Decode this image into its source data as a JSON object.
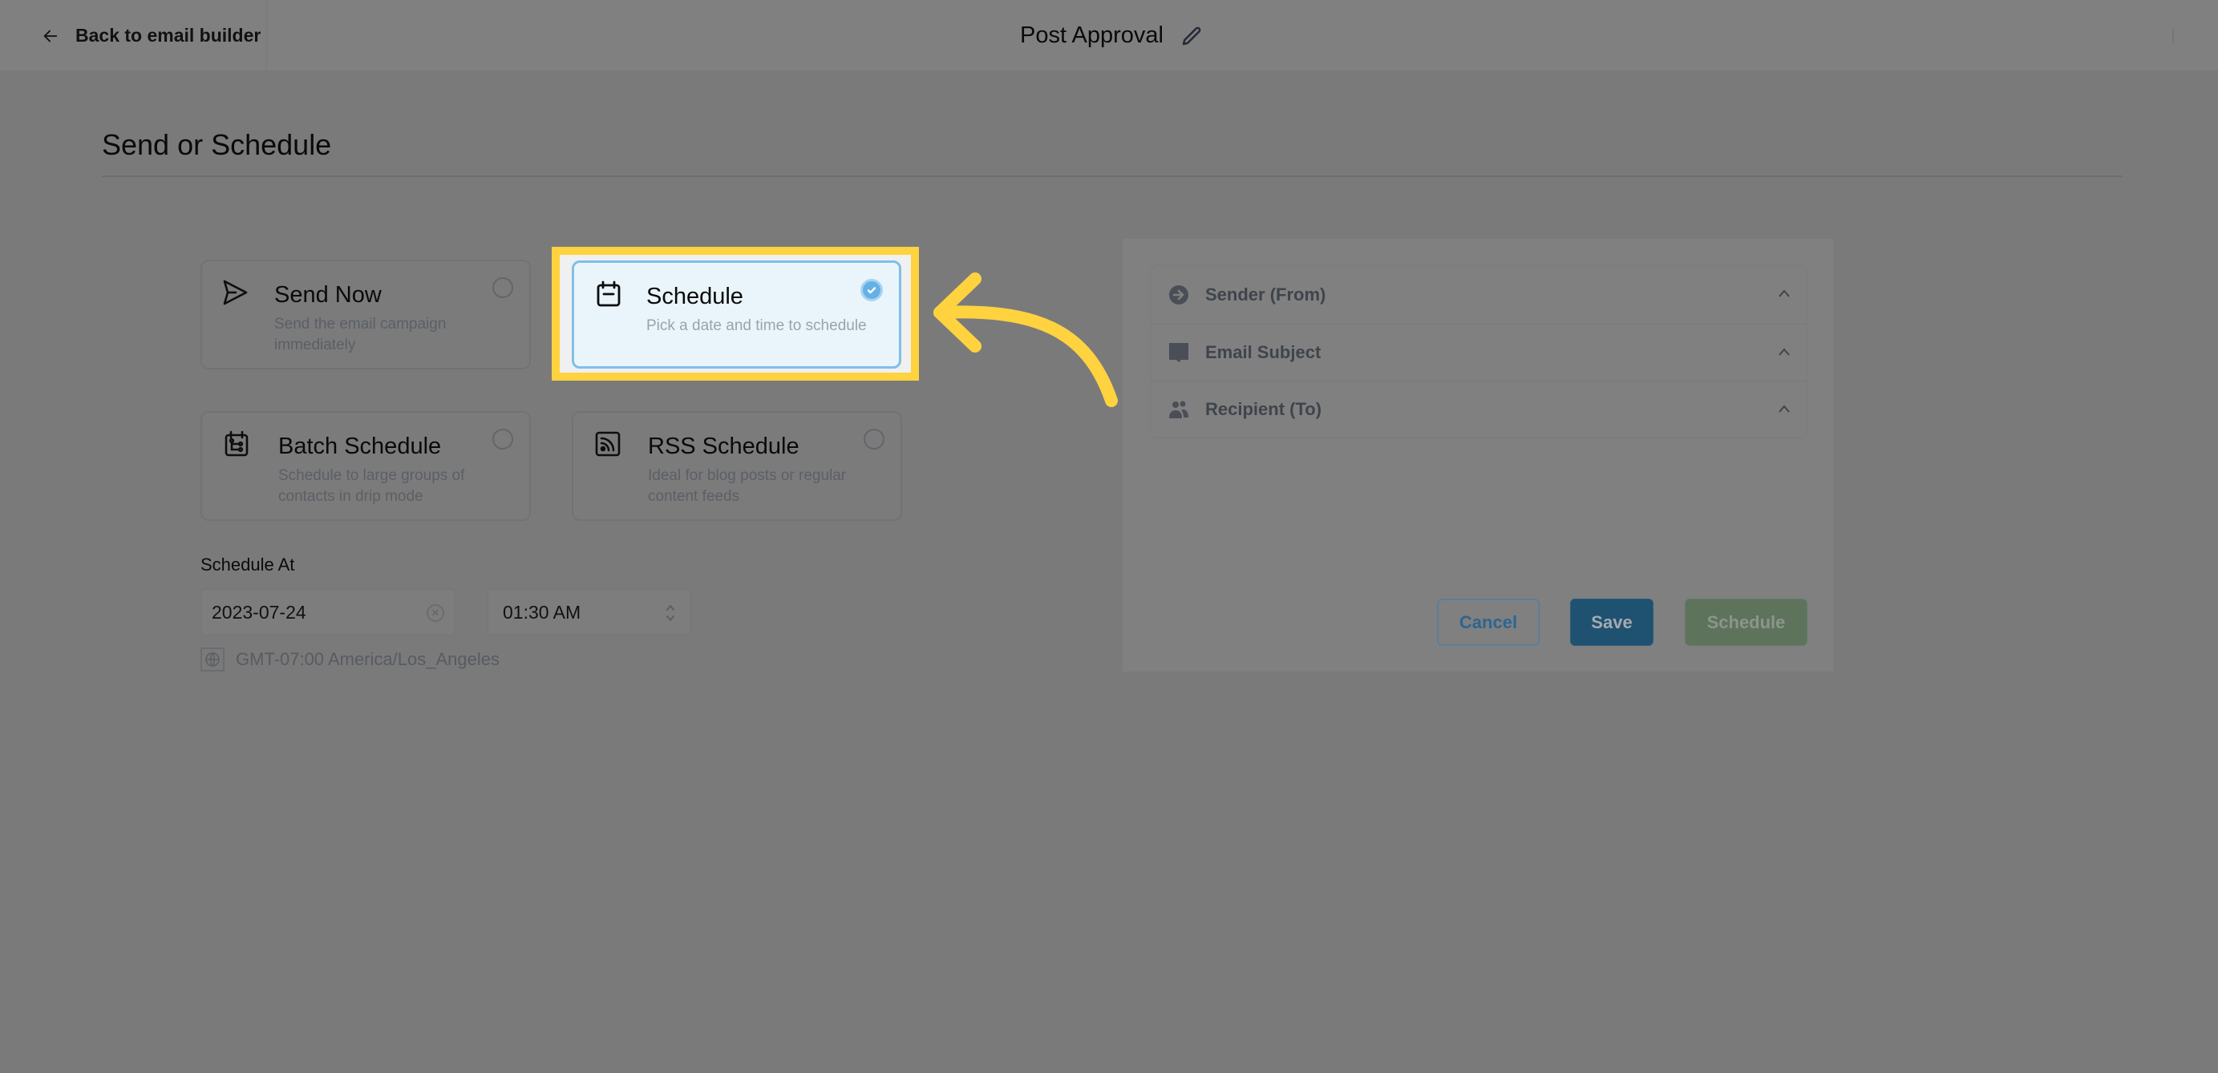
{
  "header": {
    "back_label": "Back to email builder",
    "title": "Post Approval",
    "back_icon": "arrow-left-icon",
    "edit_icon": "pencil-icon"
  },
  "page": {
    "title": "Send or Schedule"
  },
  "options": [
    {
      "key": "send_now",
      "title": "Send Now",
      "description": "Send the email campaign immediately",
      "icon": "paper-plane-icon",
      "selected": false
    },
    {
      "key": "schedule",
      "title": "Schedule",
      "description": "Pick a date and time to schedule",
      "icon": "calendar-icon",
      "selected": true
    },
    {
      "key": "batch_schedule",
      "title": "Batch Schedule",
      "description": "Schedule to large groups of contacts in drip mode",
      "icon": "calendar-tree-icon",
      "selected": false
    },
    {
      "key": "rss_schedule",
      "title": "RSS Schedule",
      "description": "Ideal for blog posts or regular content feeds",
      "icon": "rss-icon",
      "selected": false
    }
  ],
  "schedule_at": {
    "label": "Schedule At",
    "date_value": "2023-07-24",
    "time_value": "01:30 AM",
    "timezone": "GMT-07:00 America/Los_Angeles"
  },
  "summary_panel": {
    "sections": [
      {
        "label": "Sender (From)",
        "icon": "arrow-circle-right-icon"
      },
      {
        "label": "Email Subject",
        "icon": "speech-bubble-icon"
      },
      {
        "label": "Recipient (To)",
        "icon": "users-icon"
      }
    ],
    "buttons": {
      "cancel": "Cancel",
      "save": "Save",
      "schedule": "Schedule"
    }
  },
  "annotation": {
    "highlight_color": "#ffd23f",
    "target": "schedule"
  },
  "colors": {
    "selected_card_bg": "#eaf5fb",
    "selected_card_border": "#7fbfe8",
    "check_fill": "#65b1e6",
    "save_button": "#1f5171",
    "schedule_button": "#5e735c"
  }
}
